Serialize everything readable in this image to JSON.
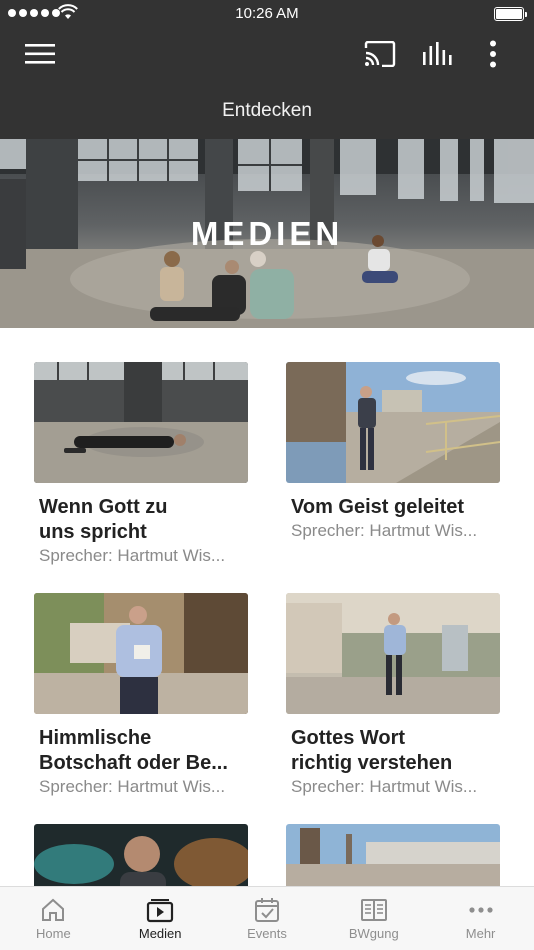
{
  "status": {
    "time": "10:26 AM"
  },
  "header": {
    "title": "Entdecken"
  },
  "hero": {
    "title": "MEDIEN"
  },
  "items": [
    {
      "title": "Wenn Gott zu\nuns spricht",
      "subtitle": "Sprecher: Hartmut Wis..."
    },
    {
      "title": "Vom Geist geleitet",
      "subtitle": "Sprecher: Hartmut Wis..."
    },
    {
      "title": "Himmlische\nBotschaft oder Be...",
      "subtitle": "Sprecher: Hartmut Wis..."
    },
    {
      "title": "Gottes Wort\nrichtig verstehen",
      "subtitle": "Sprecher: Hartmut Wis..."
    }
  ],
  "tabs": [
    {
      "label": "Home",
      "icon": "home-icon"
    },
    {
      "label": "Medien",
      "icon": "media-icon"
    },
    {
      "label": "Events",
      "icon": "calendar-icon"
    },
    {
      "label": "BWgung",
      "icon": "book-icon"
    },
    {
      "label": "Mehr",
      "icon": "more-dots-icon"
    }
  ],
  "active_tab": "Medien",
  "colors": {
    "header_bg": "#333333",
    "active_tab": "#222222",
    "inactive_tab": "#8e8e8e"
  }
}
